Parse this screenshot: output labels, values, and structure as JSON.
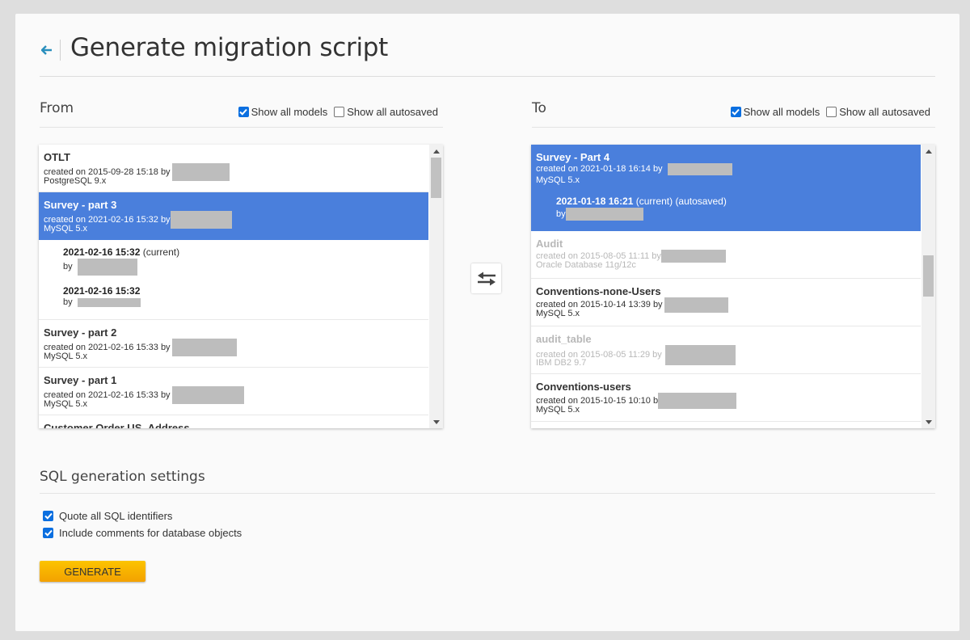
{
  "header": {
    "title": "Generate migration script",
    "back_icon": "arrow-left-icon"
  },
  "from": {
    "title": "From",
    "show_all_models": {
      "label": "Show all models",
      "checked": true
    },
    "show_all_autosaved": {
      "label": "Show all autosaved",
      "checked": false
    },
    "items": [
      {
        "name": "OTLT",
        "meta": "created on 2015-09-28 15:18 by",
        "db": "PostgreSQL 9.x",
        "selected": false,
        "dim": false
      },
      {
        "name": "Survey - part 3",
        "meta": "created on 2021-02-16 15:32 by",
        "db": "MySQL 5.x",
        "selected": true,
        "dim": false,
        "versions": [
          {
            "date": "2021-02-16 15:32",
            "note": "(current)",
            "by": "by"
          },
          {
            "date": "2021-02-16 15:32",
            "note": "",
            "by": "by"
          }
        ]
      },
      {
        "name": "Survey - part 2",
        "meta": "created on 2021-02-16 15:33 by",
        "db": "MySQL 5.x",
        "selected": false,
        "dim": false
      },
      {
        "name": "Survey - part 1",
        "meta": "created on 2021-02-16 15:33 by",
        "db": "MySQL 5.x",
        "selected": false,
        "dim": false
      },
      {
        "name": "Customer Order US_Address",
        "meta": "",
        "db": "",
        "selected": false,
        "dim": false
      }
    ]
  },
  "to": {
    "title": "To",
    "show_all_models": {
      "label": "Show all models",
      "checked": true
    },
    "show_all_autosaved": {
      "label": "Show all autosaved",
      "checked": false
    },
    "items": [
      {
        "name": "Survey - Part 4",
        "meta": "created on 2021-01-18 16:14 by",
        "db": "MySQL 5.x",
        "selected": true,
        "dim": false,
        "versions": [
          {
            "date": "2021-01-18 16:21",
            "note": "(current) (autosaved)",
            "by": "by"
          }
        ]
      },
      {
        "name": "Audit",
        "meta": "created on 2015-08-05 11:11 by",
        "db": "Oracle Database 11g/12c",
        "selected": false,
        "dim": true
      },
      {
        "name": "Conventions-none-Users",
        "meta": "created on 2015-10-14 13:39 by",
        "db": "MySQL 5.x",
        "selected": false,
        "dim": false
      },
      {
        "name": "audit_table",
        "meta": "created on 2015-08-05 11:29 by",
        "db": "IBM DB2 9.7",
        "selected": false,
        "dim": true
      },
      {
        "name": "Conventions-users",
        "meta": "created on 2015-10-15 10:10 b",
        "db": "MySQL 5.x",
        "selected": false,
        "dim": false
      }
    ]
  },
  "swap_button": {
    "icon": "swap-arrows-icon"
  },
  "settings": {
    "title": "SQL generation settings",
    "options": [
      {
        "label": "Quote all SQL identifiers",
        "checked": true
      },
      {
        "label": "Include comments for database objects",
        "checked": true
      }
    ],
    "generate_label": "GENERATE"
  },
  "colors": {
    "selection": "#4a7fdc",
    "accent": "#2a8fbd",
    "generate_button": "#f7b200"
  }
}
